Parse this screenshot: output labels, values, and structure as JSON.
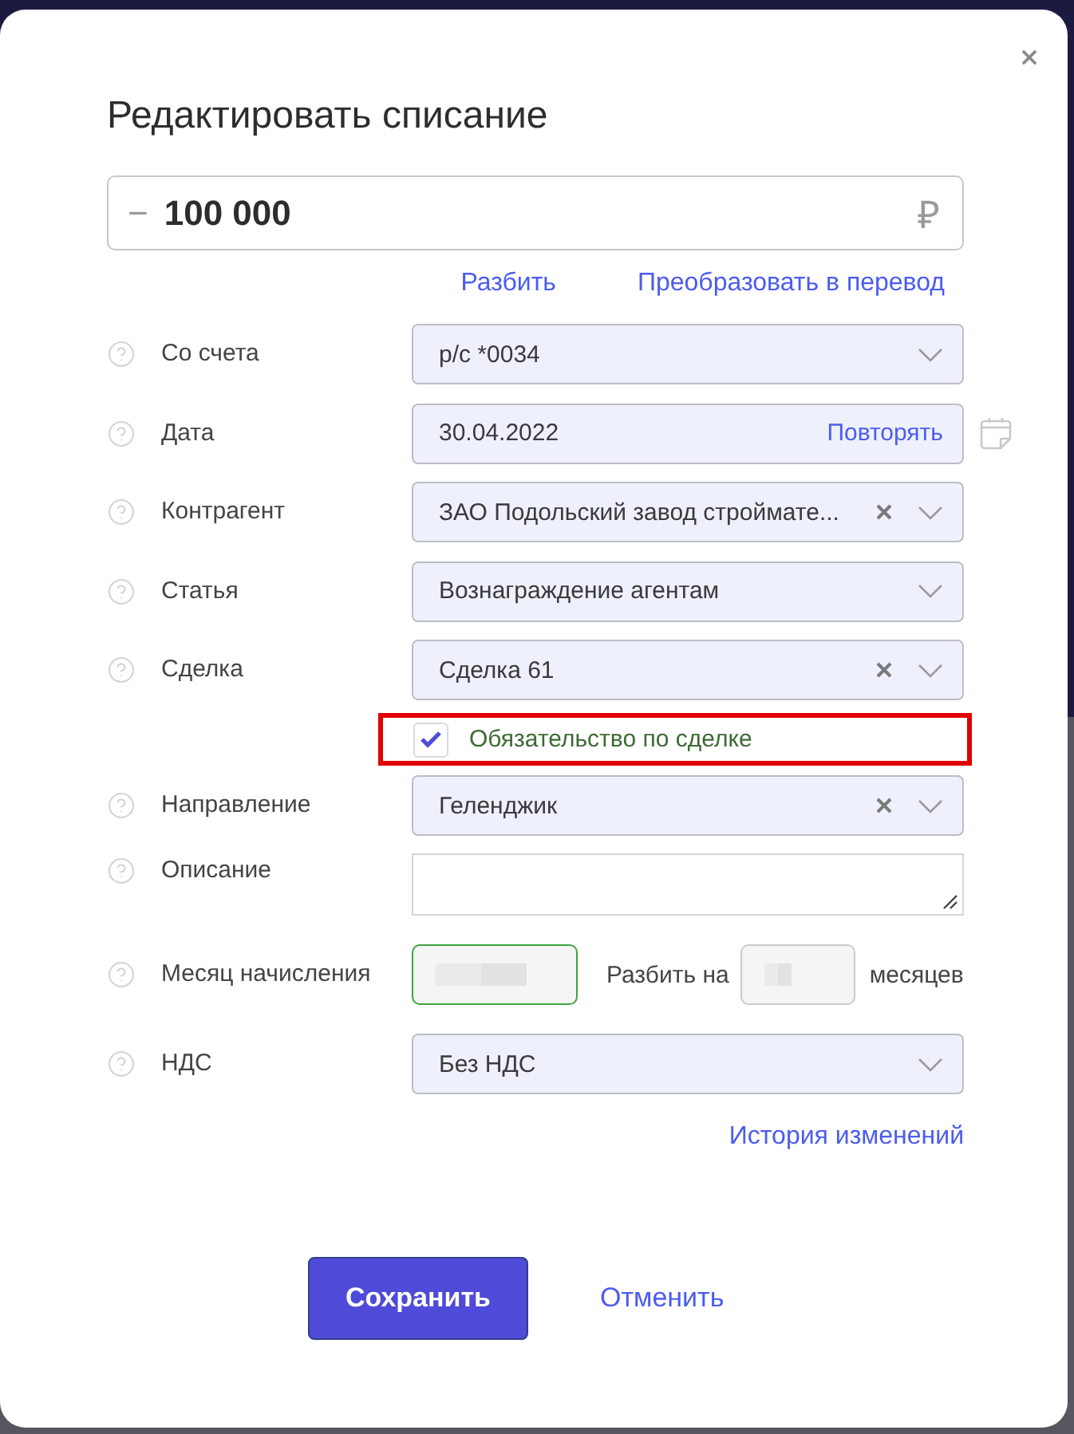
{
  "dialog": {
    "title": "Редактировать списание"
  },
  "amount": {
    "sign": "−",
    "value": "100 000",
    "currency": "₽"
  },
  "amount_links": [
    "Разбить",
    "Преобразовать в перевод"
  ],
  "fields": [
    {
      "kind": "select",
      "label": "Со счета",
      "value": "р/с *0034",
      "clearable": false
    },
    {
      "kind": "date",
      "label": "Дата",
      "value": "30.04.2022",
      "action": "Повторять"
    },
    {
      "kind": "select",
      "label": "Контрагент",
      "value": "ЗАО Подольский завод строймате...",
      "clearable": true
    },
    {
      "kind": "select",
      "label": "Статья",
      "value": "Вознаграждение агентам",
      "clearable": false
    },
    {
      "kind": "select",
      "label": "Сделка",
      "value": "Сделка 61",
      "clearable": true
    },
    {
      "kind": "checkbox",
      "label": "Обязательство по сделке",
      "checked": true,
      "highlighted": true
    },
    {
      "kind": "select",
      "label": "Направление",
      "value": "Геленджик",
      "clearable": true
    },
    {
      "kind": "textarea",
      "label": "Описание"
    },
    {
      "kind": "period",
      "label": "Месяц начисления",
      "month_focused": true,
      "month_blurred": true,
      "split_label": "Разбить на",
      "split_blurred": true,
      "unit": "месяцев"
    },
    {
      "kind": "select",
      "label": "НДС",
      "value": "Без НДС",
      "clearable": false
    }
  ],
  "history_link": "История изменений",
  "buttons": [
    {
      "kind": "primary",
      "label": "Сохранить"
    },
    {
      "kind": "link",
      "label": "Отменить"
    }
  ]
}
